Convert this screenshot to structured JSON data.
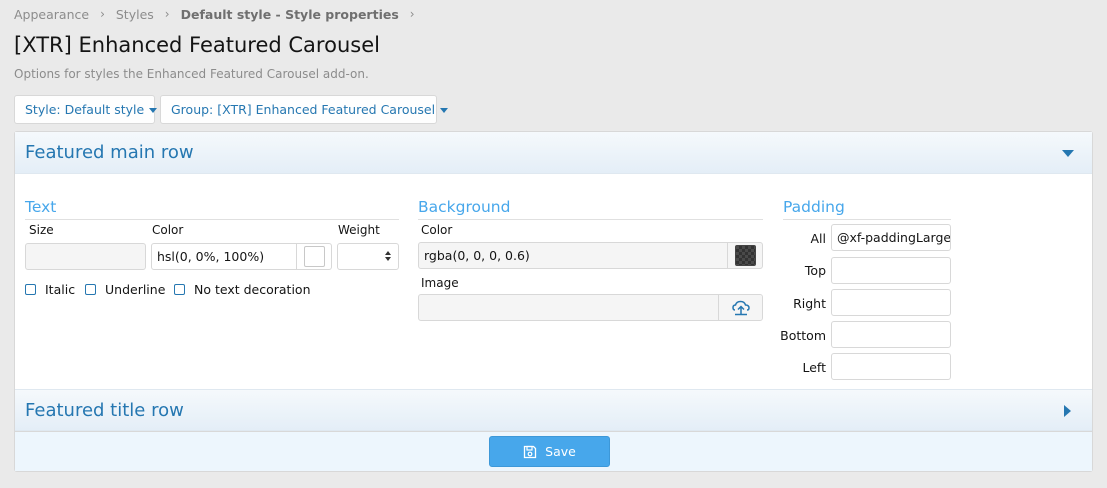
{
  "breadcrumb": {
    "items": [
      "Appearance",
      "Styles",
      "Default style - Style properties"
    ]
  },
  "page": {
    "title": "[XTR] Enhanced Featured Carousel",
    "description": "Options for styles the Enhanced Featured Carousel add-on."
  },
  "filters": {
    "style_label": "Style: Default style",
    "group_label": "Group: [XTR] Enhanced Featured Carousel"
  },
  "sections": {
    "main": {
      "title": "Featured main row",
      "text": {
        "title": "Text",
        "size_label": "Size",
        "size_value": "",
        "color_label": "Color",
        "color_value": "hsl(0, 0%, 100%)",
        "weight_label": "Weight",
        "weight_value": "",
        "checkboxes": [
          "Italic",
          "Underline",
          "No text decoration"
        ]
      },
      "background": {
        "title": "Background",
        "color_label": "Color",
        "color_value": "rgba(0, 0, 0, 0.6)",
        "image_label": "Image",
        "image_value": ""
      },
      "padding": {
        "title": "Padding",
        "all_label": "All",
        "all_value": "@xf-paddingLarge",
        "top_label": "Top",
        "right_label": "Right",
        "bottom_label": "Bottom",
        "left_label": "Left"
      }
    },
    "title_row": {
      "title": "Featured title row"
    }
  },
  "footer": {
    "save_label": "Save"
  },
  "colors": {
    "accent": "#2577b1",
    "accent_light": "#47a7eb",
    "text_swatch": "#ffffff",
    "bg_swatch": "rgba(0, 0, 0, 0.6)"
  },
  "icons": {
    "breadcrumb_separator": "chevron-right-icon",
    "section_open": "caret-down-icon",
    "section_closed": "caret-right-icon",
    "upload": "upload-icon",
    "save": "save-icon"
  }
}
